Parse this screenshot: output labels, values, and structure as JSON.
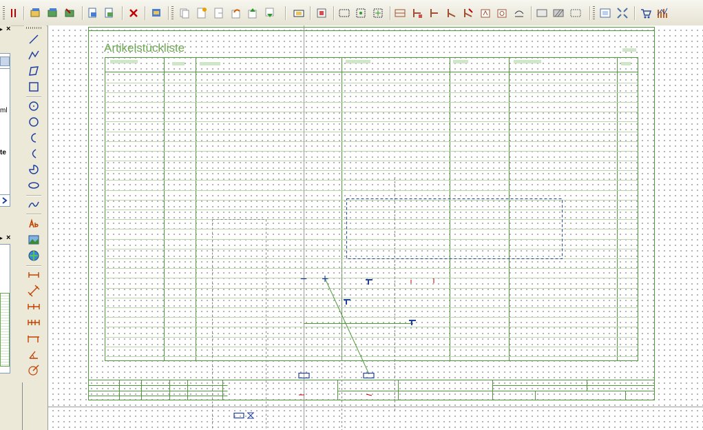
{
  "app": {
    "accent_color": "#c00000",
    "drawing_line_color": "#4e9a3a",
    "selection_color": "#1f3fa0"
  },
  "toolbar": {
    "icons": [
      "pin-icon",
      "open-project-icon",
      "save-project-icon",
      "close-project-icon",
      "new-page-icon",
      "import-page-icon",
      "delete-page-icon",
      "page-properties-icon",
      "copy-icon",
      "new-document-icon",
      "document-icon",
      "undo-icon",
      "move-up-icon",
      "move-down-icon",
      "symbol-icon",
      "print-icon",
      "grid-icon",
      "snap-icon",
      "snap-center-icon",
      "bom-icon",
      "connector-icon",
      "wire-icon",
      "terminal-icon",
      "cable-icon",
      "device-icon",
      "plc-icon",
      "bridge-icon",
      "text-field-icon",
      "hatch-icon",
      "frame-icon",
      "zoom-window-icon",
      "zoom-fit-icon",
      "shop-icon",
      "report-icon"
    ]
  },
  "left_panels": {
    "panel1": {
      "close_label": "×",
      "pin_label": "▸",
      "items": [
        "ml",
        "te"
      ]
    },
    "panel2": {
      "close_label": "×",
      "pin_label": "▸"
    }
  },
  "draw_toolbar": {
    "icons": [
      "line-icon",
      "polyline-icon",
      "polygon-icon",
      "rectangle-icon",
      "circle-center-icon",
      "circle-icon",
      "arc-icon",
      "arc-three-point-icon",
      "sector-icon",
      "ellipse-icon",
      "spline-icon",
      "text-icon",
      "image-icon",
      "ole-object-icon",
      "dimension-icon",
      "dimension-aligned-icon",
      "dimension-chain-icon",
      "dimension-baseline-icon",
      "dimension-incremental-icon",
      "angle-dimension-icon",
      "radius-dimension-icon"
    ]
  },
  "canvas": {
    "sheet_title": "Artikelstückliste",
    "header_cells": [
      "",
      "",
      "",
      "",
      "",
      "",
      "",
      ""
    ]
  }
}
